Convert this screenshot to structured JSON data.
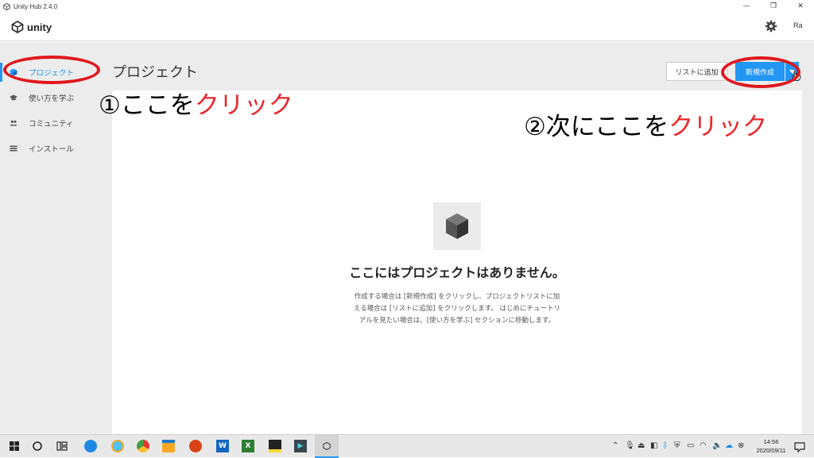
{
  "window": {
    "title": "Unity Hub 2.4.0",
    "controls": {
      "minimize": "—",
      "restore": "❐",
      "close": "✕"
    }
  },
  "header": {
    "logo_text": "unity",
    "account_initials": "Ra"
  },
  "sidebar": {
    "items": [
      {
        "label": "プロジェクト",
        "icon": "cube-icon",
        "active": true
      },
      {
        "label": "使い方を学ぶ",
        "icon": "graduation-cap-icon",
        "active": false
      },
      {
        "label": "コミュニティ",
        "icon": "people-icon",
        "active": false
      },
      {
        "label": "インストール",
        "icon": "list-icon",
        "active": false
      }
    ]
  },
  "main": {
    "title": "プロジェクト",
    "add_to_list_label": "リストに追加",
    "new_project_label": "新規作成",
    "empty_title": "ここにはプロジェクトはありません。",
    "empty_desc_1": "作成する場合は [新規作成] をクリックし、プロジェクトリストに加",
    "empty_desc_2": "える場合は [リストに追加] をクリックします。 はじめにチュートリ",
    "empty_desc_3": "アルを見たい場合は、[使い方を学ぶ] セクションに移動します。"
  },
  "annotations": {
    "step1_prefix": "①ここを",
    "step1_emph": "クリック",
    "step2_prefix": "②次にここを",
    "step2_emph": "クリック"
  },
  "taskbar": {
    "time": "14:56",
    "date": "2020/09/11"
  },
  "colors": {
    "accent": "#2196f3",
    "annotation_red": "#e0161b"
  }
}
